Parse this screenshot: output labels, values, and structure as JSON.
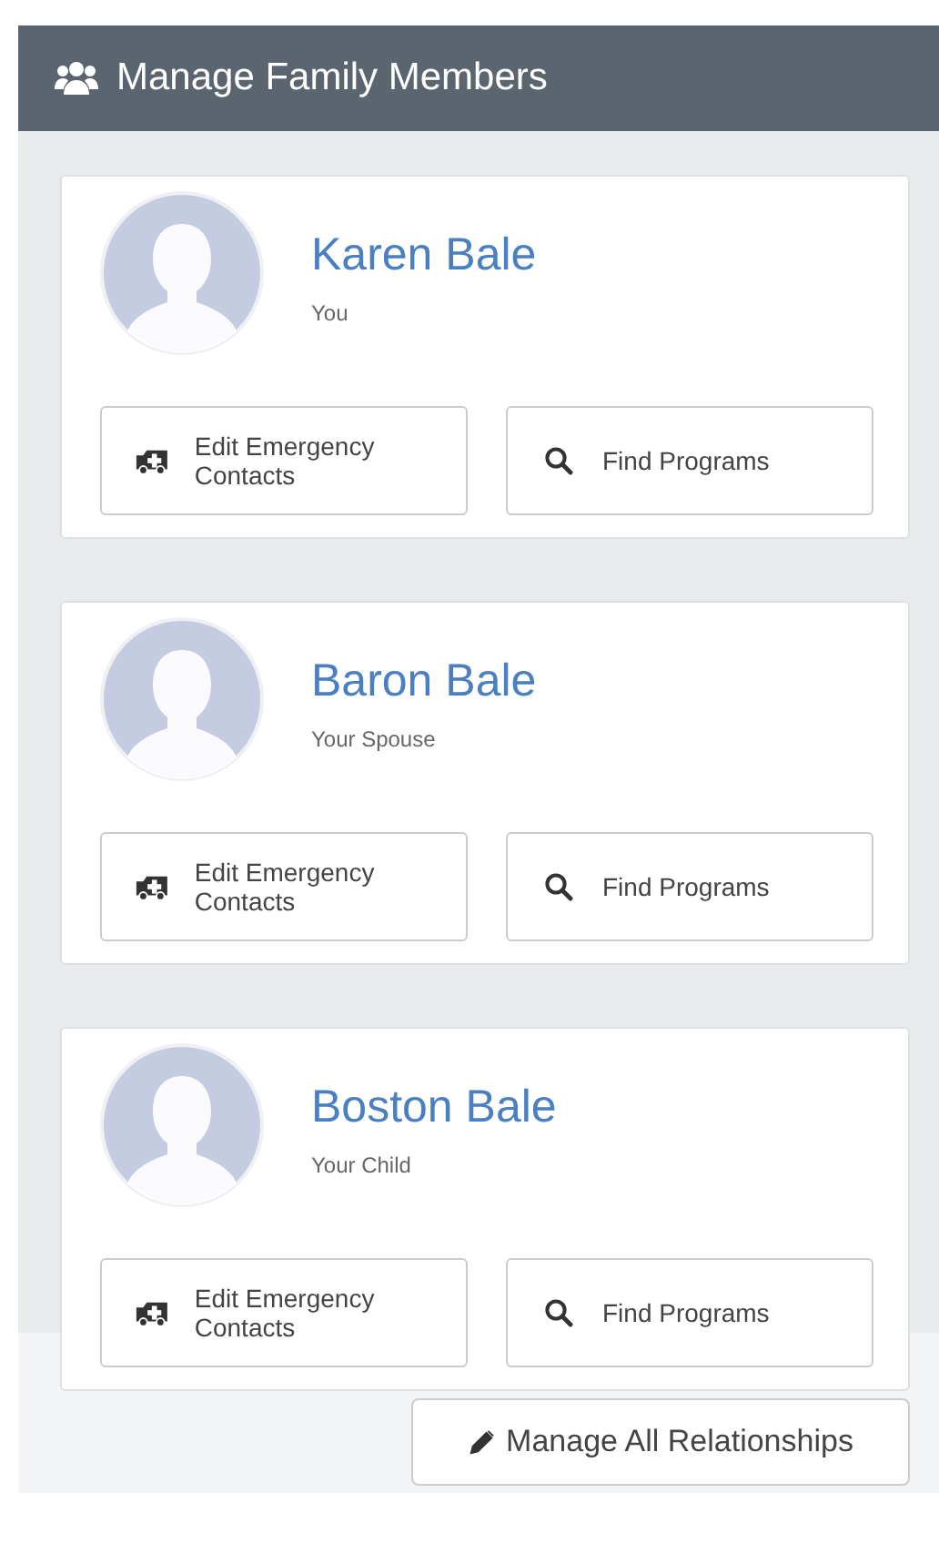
{
  "panel": {
    "title": "Manage Family Members"
  },
  "members": [
    {
      "name": "Karen Bale",
      "relation": "You",
      "buttons": [
        "Edit Emergency Contacts",
        "Find Programs"
      ]
    },
    {
      "name": "Baron Bale",
      "relation": "Your Spouse",
      "buttons": [
        "Edit Emergency Contacts",
        "Find Programs"
      ]
    },
    {
      "name": "Boston Bale",
      "relation": "Your Child",
      "buttons": [
        "Edit Emergency Contacts",
        "Find Programs"
      ]
    }
  ],
  "footer": {
    "button": "Manage All Relationships"
  }
}
